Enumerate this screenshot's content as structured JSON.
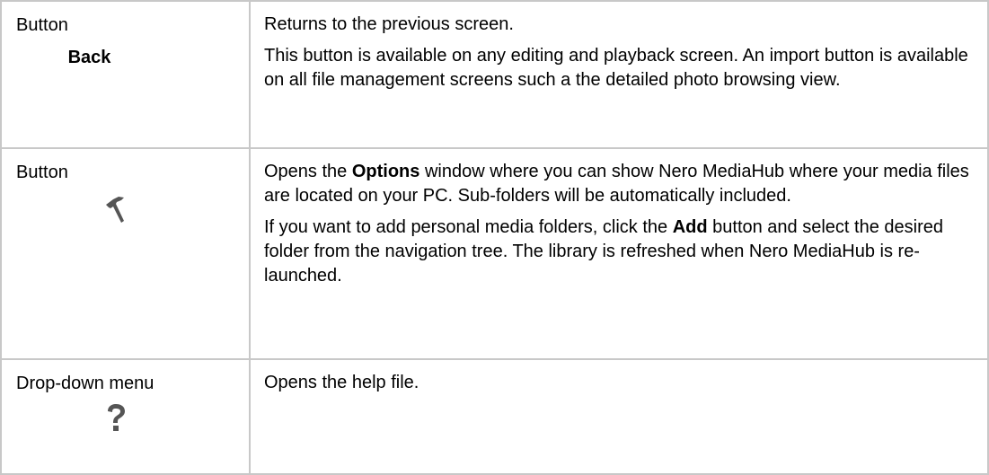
{
  "rows": [
    {
      "type": "Button",
      "label": "Back",
      "desc_p1": "Returns to the previous screen.",
      "desc_p2": "This button is available on any editing and playback screen. An import button is available on all file management screens such a the detailed photo browsing view."
    },
    {
      "type": "Button",
      "icon": "hammer-icon",
      "desc_p1_before": "Opens the ",
      "desc_p1_bold": "Options",
      "desc_p1_after": " window where you can show Nero MediaHub where your media files are located on your PC. Sub-folders will be automatically included.",
      "desc_p2_before": "If you want to add personal media folders, click the ",
      "desc_p2_bold": "Add",
      "desc_p2_after": " button and select the desired folder from the navigation tree. The library is refreshed when Nero MediaHub is re-launched."
    },
    {
      "type": "Drop-down menu",
      "icon": "help-question-icon",
      "desc_p1": "Opens the help file."
    }
  ],
  "colors": {
    "border": "#c8c8c8",
    "icon": "#555555"
  }
}
